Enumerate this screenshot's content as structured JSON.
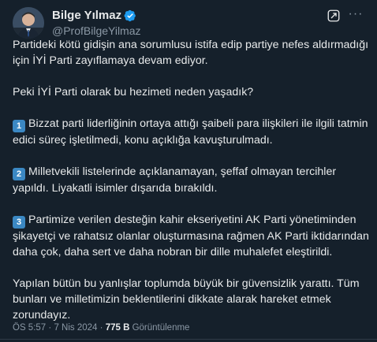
{
  "author": {
    "display_name": "Bilge Yılmaz",
    "handle": "@ProfBilgeYilmaz",
    "verified_icon": "verified-badge-icon",
    "avatar_icon": "profile-photo-icon"
  },
  "actions": {
    "more_label": "···"
  },
  "tweet": {
    "paragraphs": [
      {
        "marker": "",
        "text": "Partideki kötü gidişin ana sorumlusu istifa edip partiye nefes aldırmadığı için İYİ Parti zayıflamaya devam ediyor."
      },
      {
        "marker": "",
        "text": "Peki İYİ Parti olarak bu hezimeti neden yaşadık?"
      },
      {
        "marker": "1",
        "text": "Bizzat parti liderliğinin ortaya attığı şaibeli para ilişkileri ile ilgili tatmin edici süreç işletilmedi, konu açıklığa kavuşturulmadı."
      },
      {
        "marker": "2",
        "text": "Milletvekili listelerinde açıklanamayan, şeffaf olmayan tercihler yapıldı. Liyakatli isimler dışarıda bırakıldı."
      },
      {
        "marker": "3",
        "text": "Partimize verilen desteğin kahir ekseriyetini AK Parti yönetiminden şikayetçi ve rahatsız olanlar oluşturmasına rağmen AK Parti iktidarından daha çok, daha sert ve daha nobran bir dille muhalefet eleştirildi."
      },
      {
        "marker": "",
        "text": "Yapılan bütün bu yanlışlar toplumda büyük bir güvensizlik yarattı. Tüm bunları ve milletimizin beklentilerini dikkate alarak hareket etmek zorundayız."
      }
    ]
  },
  "meta": {
    "time": "ÖS 5:57",
    "separator": "·",
    "date": "7 Nis 2024",
    "views_count": "775 B",
    "views_label": "Görüntülenme"
  },
  "colors": {
    "background": "#15202b",
    "text": "#e7e9ea",
    "secondary": "#8b98a5",
    "verified": "#1d9bf0",
    "keycap": "#3b88c3"
  }
}
